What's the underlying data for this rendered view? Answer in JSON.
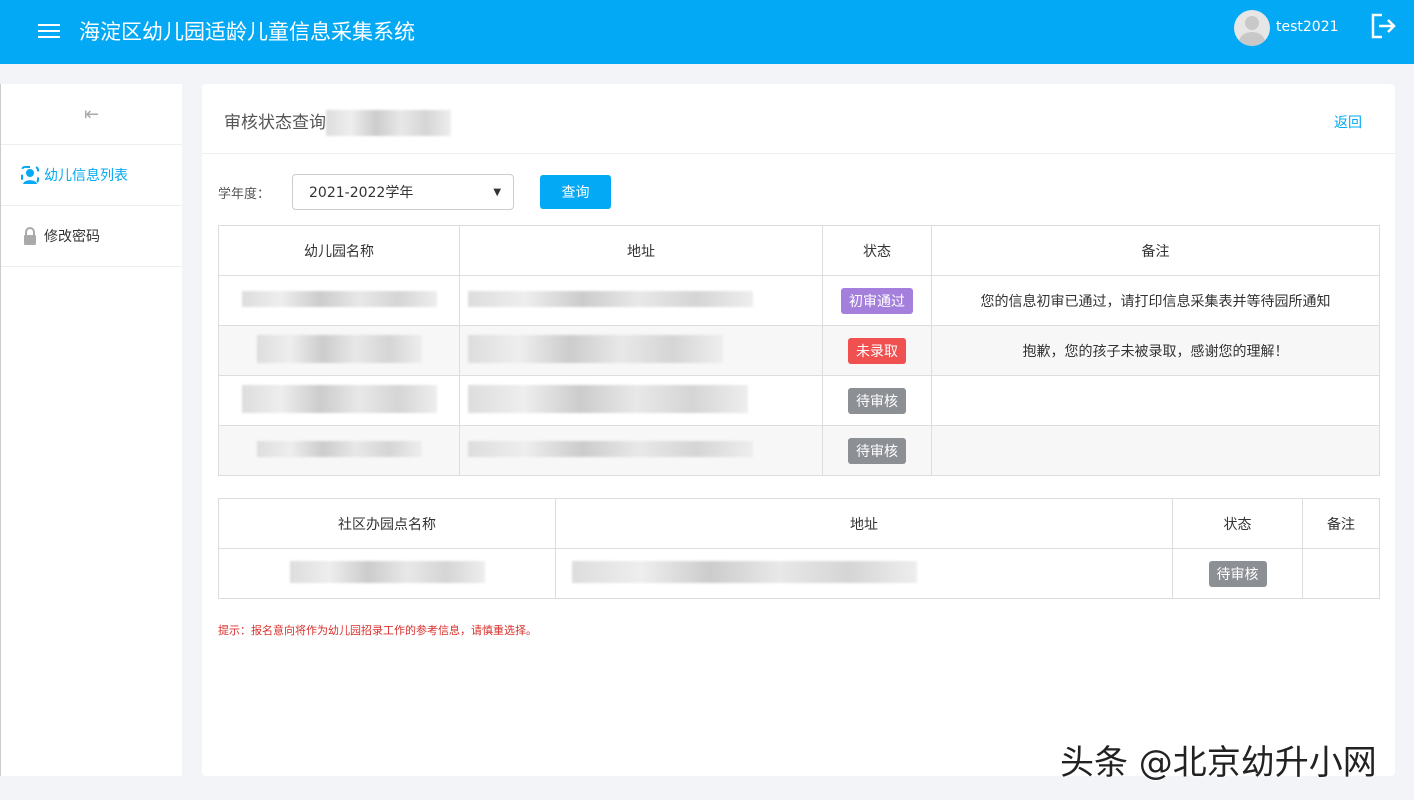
{
  "header": {
    "title": "海淀区幼儿园适龄儿童信息采集系统",
    "username": "test2021"
  },
  "sidebar": {
    "items": [
      {
        "label": "幼儿信息列表"
      },
      {
        "label": "修改密码"
      }
    ]
  },
  "page": {
    "title": "审核状态查询",
    "back": "返回"
  },
  "filter": {
    "label": "学年度：",
    "selected": "2021-2022学年",
    "query": "查询"
  },
  "table1": {
    "headers": [
      "幼儿园名称",
      "地址",
      "状态",
      "备注"
    ],
    "rows": [
      {
        "status": "初审通过",
        "status_color": "#a57fdc",
        "remark": "您的信息初审已通过，请打印信息采集表并等待园所通知"
      },
      {
        "status": "未录取",
        "status_color": "#f05050",
        "remark": "抱歉，您的孩子未被录取，感谢您的理解！"
      },
      {
        "status": "待审核",
        "status_color": "#8c8f94",
        "remark": ""
      },
      {
        "status": "待审核",
        "status_color": "#8c8f94",
        "remark": ""
      }
    ]
  },
  "table2": {
    "headers": [
      "社区办园点名称",
      "地址",
      "状态",
      "备注"
    ],
    "rows": [
      {
        "status": "待审核",
        "status_color": "#8c8f94",
        "remark": ""
      }
    ]
  },
  "note": "提示：报名意向将作为幼儿园招录工作的参考信息，请慎重选择。",
  "watermark": "头条 @北京幼升小网"
}
